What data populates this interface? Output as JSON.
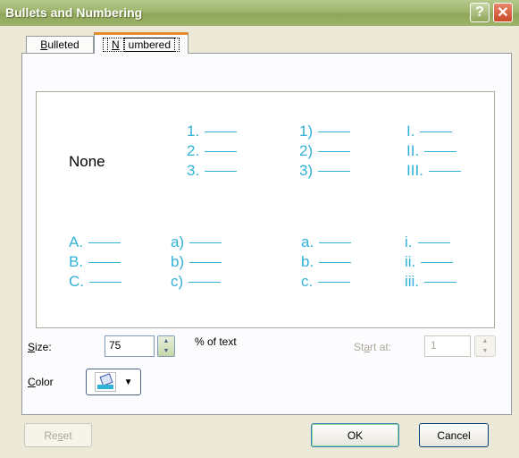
{
  "window": {
    "title": "Bullets and Numbering",
    "help_glyph": "?",
    "close_glyph": "✕"
  },
  "tabs": [
    {
      "label_prefix": "B",
      "label_rest": "ulleted"
    },
    {
      "label_prefix": "N",
      "label_rest": "umbered"
    }
  ],
  "styles": {
    "none_label": "None",
    "cells": [
      [
        "1.",
        "2.",
        "3."
      ],
      [
        "1)",
        "2)",
        "3)"
      ],
      [
        "I.",
        "II.",
        "III."
      ],
      [
        "A.",
        "B.",
        "C."
      ],
      [
        "a)",
        "b)",
        "c)"
      ],
      [
        "a.",
        "b.",
        "c."
      ],
      [
        "i.",
        "ii.",
        "iii."
      ]
    ]
  },
  "size": {
    "label_prefix": "S",
    "label_rest": "ize:",
    "value": "75",
    "suffix": "% of text"
  },
  "start_at": {
    "label_pre": "St",
    "label_ul": "a",
    "label_post": "rt at:",
    "value": "1"
  },
  "color": {
    "label_prefix": "C",
    "label_rest": "olor",
    "value_hex": "#31b2d6"
  },
  "buttons": {
    "reset_pre": "Re",
    "reset_ul": "s",
    "reset_post": "et",
    "ok": "OK",
    "cancel": "Cancel"
  }
}
